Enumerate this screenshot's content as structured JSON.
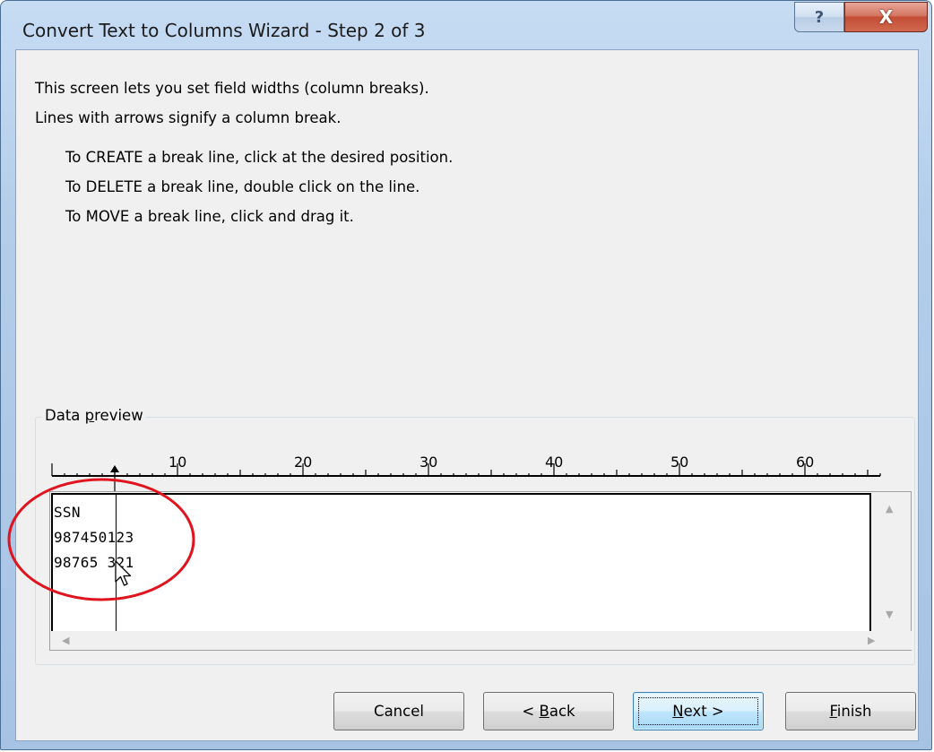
{
  "window": {
    "title": "Convert Text to Columns Wizard - Step 2 of 3",
    "help_label": "?",
    "close_label": "X"
  },
  "intro": {
    "line1": "This screen lets you set field widths (column breaks).",
    "line2": "Lines with arrows signify a column break."
  },
  "instructions": [
    "To CREATE a break line, click at the desired position.",
    "To DELETE a break line, double click on the line.",
    "To MOVE a break line, click and drag it."
  ],
  "data_preview": {
    "label_prefix": "Data ",
    "label_mnemonic": "p",
    "label_suffix": "review",
    "ruler_marks": [
      "10",
      "20",
      "30",
      "40",
      "50",
      "60"
    ],
    "lines": [
      "SSN",
      "987450123",
      "98765 321"
    ],
    "break_after_char": 5
  },
  "buttons": {
    "cancel": "Cancel",
    "back_prefix": "< ",
    "back_mnemonic": "B",
    "back_suffix": "ack",
    "next_mnemonic": "N",
    "next_suffix": "ext >",
    "finish_mnemonic": "F",
    "finish_suffix": "inish"
  },
  "icons": {
    "help": "help-icon",
    "close": "close-icon",
    "cursor": "mouse-pointer-icon",
    "scroll_up": "scroll-up-arrow-icon",
    "scroll_down": "scroll-down-arrow-icon",
    "scroll_left": "scroll-left-arrow-icon",
    "scroll_right": "scroll-right-arrow-icon"
  },
  "annotation": {
    "highlight_color": "#e0141e"
  }
}
